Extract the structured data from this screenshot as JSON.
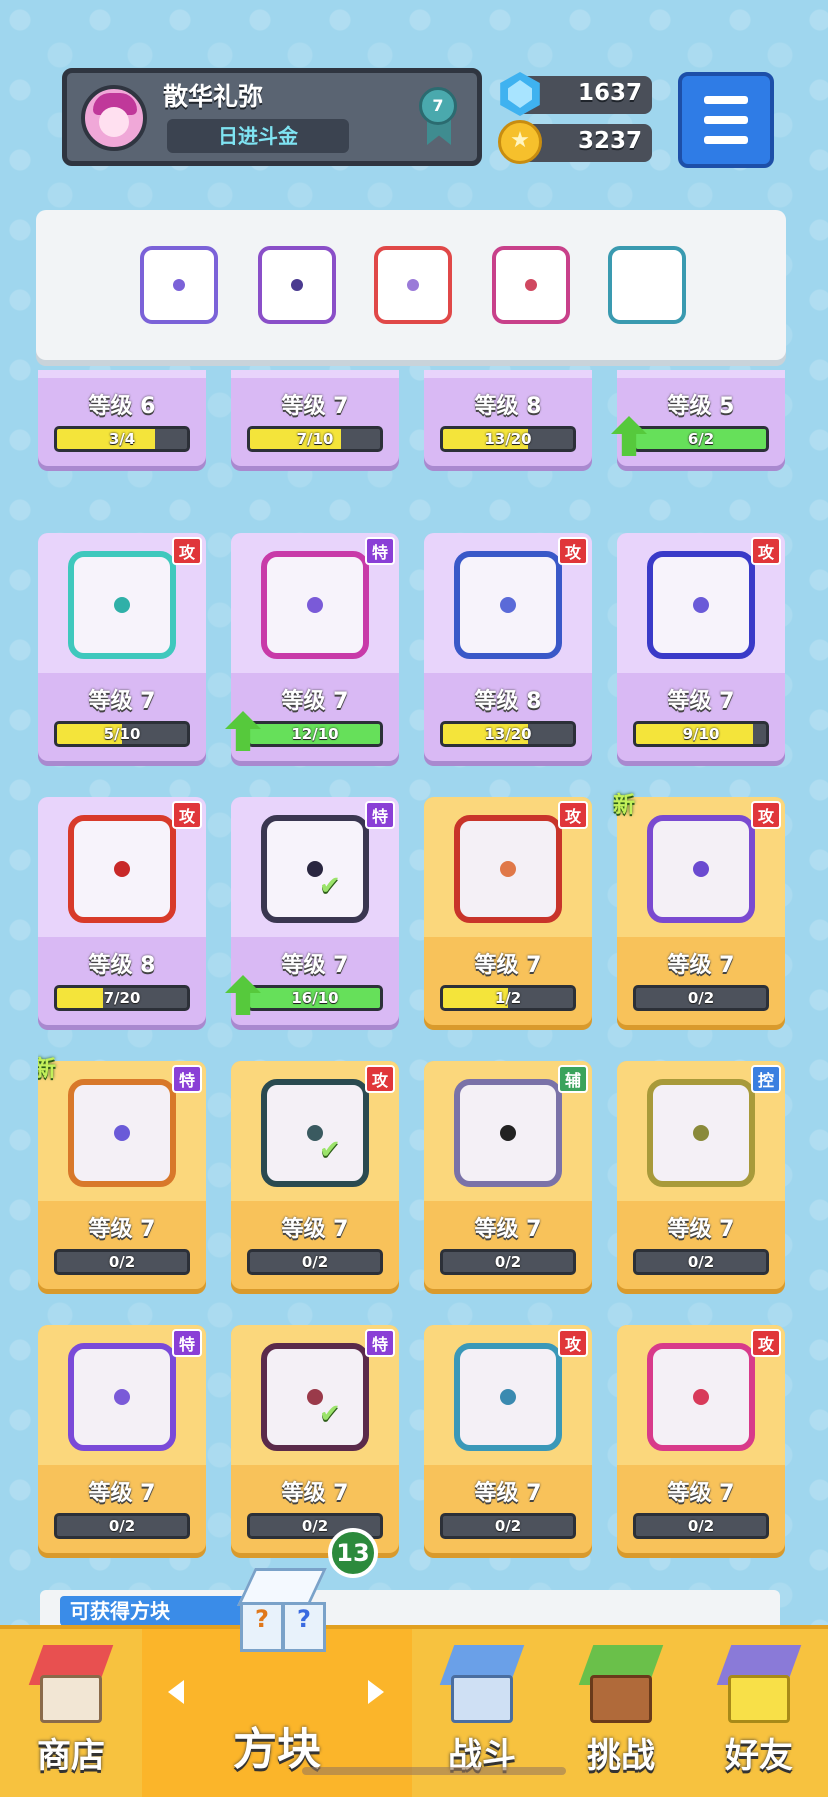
{
  "header": {
    "player_name": "散华礼弥",
    "player_title": "日进斗金",
    "rank": "7",
    "gems": "1637",
    "coins": "3237"
  },
  "colors": {
    "accent_blue": "#2f7ce6",
    "tag_attack": "#e0363a",
    "tag_special": "#8a3fd6",
    "tag_support": "#3aa35c",
    "tag_control": "#3a7fe0",
    "progress_yellow": "#f4e43a",
    "progress_green": "#66e05a"
  },
  "deck": [
    {
      "icon": "wind-dice-icon",
      "border": "#7b62d8",
      "dot": "#7b62d8"
    },
    {
      "icon": "lightning-dice-icon",
      "border": "#8a4fc8",
      "dot": "#4a3a90"
    },
    {
      "icon": "rainbow-dice-icon",
      "border": "#e04848",
      "dot": "#9a7ad8"
    },
    {
      "icon": "sword-dragon-dice-icon",
      "border": "#c8408a",
      "dot": "#d04860"
    },
    {
      "icon": "ice-dragon-dice-icon",
      "border": "#3a9ab0",
      "dot": "#ffffff"
    }
  ],
  "cards_partial": [
    {
      "level": "等级 6",
      "progress": "3/4",
      "fill": 0.75,
      "bar": "yellow",
      "upgrade": false
    },
    {
      "level": "等级 7",
      "progress": "7/10",
      "fill": 0.7,
      "bar": "yellow",
      "upgrade": false
    },
    {
      "level": "等级 8",
      "progress": "13/20",
      "fill": 0.65,
      "bar": "yellow",
      "upgrade": false
    },
    {
      "level": "等级 5",
      "progress": "6/2",
      "fill": 1,
      "bar": "green",
      "upgrade": true
    }
  ],
  "cards": [
    {
      "tier": "purple",
      "tag": "攻",
      "tag_type": "gong",
      "level": "等级 7",
      "progress": "5/10",
      "fill": 0.5,
      "bar": "yellow",
      "upgrade": false,
      "art_border": "#3fc8bd",
      "pip": "#30b0a8",
      "icon": "wind-swirl-dice-icon",
      "check": false,
      "new": false
    },
    {
      "tier": "purple",
      "tag": "特",
      "tag_type": "te",
      "level": "等级 7",
      "progress": "12/10",
      "fill": 1,
      "bar": "green",
      "upgrade": true,
      "art_border": "#c83aa8",
      "pip": "#7a5ad8",
      "icon": "teleport-dice-icon",
      "check": false,
      "new": false
    },
    {
      "tier": "purple",
      "tag": "攻",
      "tag_type": "gong",
      "level": "等级 8",
      "progress": "13/20",
      "fill": 0.65,
      "bar": "yellow",
      "upgrade": false,
      "art_border": "#3a58c8",
      "pip": "#5a6ad8",
      "icon": "gear-dice-icon",
      "check": false,
      "new": false
    },
    {
      "tier": "purple",
      "tag": "攻",
      "tag_type": "gong",
      "level": "等级 7",
      "progress": "9/10",
      "fill": 0.9,
      "bar": "yellow",
      "upgrade": false,
      "art_border": "#3a3ac8",
      "pip": "#6a5ad8",
      "icon": "bubble-dice-icon",
      "check": false,
      "new": false
    },
    {
      "tier": "purple",
      "tag": "攻",
      "tag_type": "gong",
      "level": "等级 8",
      "progress": "7/20",
      "fill": 0.35,
      "bar": "yellow",
      "upgrade": false,
      "art_border": "#d83a2a",
      "pip": "#c82828",
      "icon": "fire-dice-icon",
      "check": false,
      "new": false
    },
    {
      "tier": "purple",
      "tag": "特",
      "tag_type": "te",
      "level": "等级 7",
      "progress": "16/10",
      "fill": 1,
      "bar": "green",
      "upgrade": true,
      "art_border": "#3a3650",
      "pip": "#2a2640",
      "icon": "dark-crack-dice-icon",
      "check": true,
      "new": false
    },
    {
      "tier": "gold",
      "tag": "攻",
      "tag_type": "gong",
      "level": "等级 7",
      "progress": "1/2",
      "fill": 0.5,
      "bar": "yellow",
      "upgrade": false,
      "art_border": "#c8342a",
      "pip": "#e07848",
      "icon": "star-dragon-dice-icon",
      "check": false,
      "new": false
    },
    {
      "tier": "gold",
      "tag": "攻",
      "tag_type": "gong",
      "level": "等级 7",
      "progress": "0/2",
      "fill": 0,
      "bar": "yellow",
      "upgrade": false,
      "art_border": "#7a4ad0",
      "pip": "#6a4ad0",
      "icon": "target-dragon-dice-icon",
      "check": false,
      "new": true
    },
    {
      "tier": "gold",
      "tag": "特",
      "tag_type": "te",
      "level": "等级 7",
      "progress": "0/2",
      "fill": 0,
      "bar": "yellow",
      "upgrade": false,
      "art_border": "#d8782a",
      "pip": "#6a5ad8",
      "icon": "infinity-dragon-dice-icon",
      "check": false,
      "new": true
    },
    {
      "tier": "gold",
      "tag": "攻",
      "tag_type": "gong",
      "level": "等级 7",
      "progress": "0/2",
      "fill": 0,
      "bar": "yellow",
      "upgrade": false,
      "art_border": "#2a4a50",
      "pip": "#3a5a60",
      "icon": "trident-dragon-dice-icon",
      "check": true,
      "new": false
    },
    {
      "tier": "gold",
      "tag": "辅",
      "tag_type": "fu",
      "level": "等级 7",
      "progress": "0/2",
      "fill": 0,
      "bar": "yellow",
      "upgrade": false,
      "art_border": "#7a72a8",
      "pip": "#222222",
      "icon": "jaw-dragon-dice-icon",
      "check": false,
      "new": false
    },
    {
      "tier": "gold",
      "tag": "控",
      "tag_type": "kong",
      "level": "等级 7",
      "progress": "0/2",
      "fill": 0,
      "bar": "yellow",
      "upgrade": false,
      "art_border": "#a89a3a",
      "pip": "#8a8a3a",
      "icon": "shield-dragon-dice-icon",
      "check": false,
      "new": false
    },
    {
      "tier": "gold",
      "tag": "特",
      "tag_type": "te",
      "level": "等级 7",
      "progress": "0/2",
      "fill": 0,
      "bar": "yellow",
      "upgrade": false,
      "art_border": "#7a4ad8",
      "pip": "#7a5ad8",
      "icon": "arrow-dragon-dice-icon",
      "check": false,
      "new": false
    },
    {
      "tier": "gold",
      "tag": "特",
      "tag_type": "te",
      "level": "等级 7",
      "progress": "0/2",
      "fill": 0,
      "bar": "yellow",
      "upgrade": false,
      "art_border": "#5a2a4a",
      "pip": "#9a3a4a",
      "icon": "cross-sword-dragon-dice-icon",
      "check": true,
      "new": false
    },
    {
      "tier": "gold",
      "tag": "攻",
      "tag_type": "gong",
      "level": "等级 7",
      "progress": "0/2",
      "fill": 0,
      "bar": "yellow",
      "upgrade": false,
      "art_border": "#3a98b8",
      "pip": "#3a8ab0",
      "icon": "whirlpool-dragon-dice-icon",
      "check": false,
      "new": false
    },
    {
      "tier": "gold",
      "tag": "攻",
      "tag_type": "gong",
      "level": "等级 7",
      "progress": "0/2",
      "fill": 0,
      "bar": "yellow",
      "upgrade": false,
      "art_border": "#d83a8a",
      "pip": "#d83a5a",
      "icon": "combo-dragon-dice-icon",
      "check": false,
      "new": false
    }
  ],
  "bottom_strip_label": "可获得方块",
  "tabs": [
    {
      "label": "商店",
      "icon": "shop-icon"
    },
    {
      "label": "方块",
      "icon": "dice-box-icon",
      "badge": "13"
    },
    {
      "label": "战斗",
      "icon": "battle-icon"
    },
    {
      "label": "挑战",
      "icon": "challenge-icon"
    },
    {
      "label": "好友",
      "icon": "friends-icon"
    }
  ]
}
